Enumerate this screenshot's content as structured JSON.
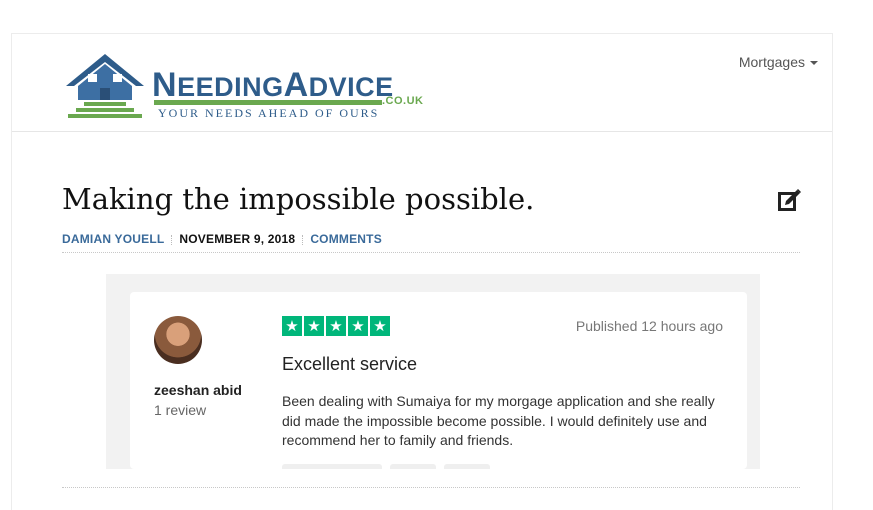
{
  "logo": {
    "name_big_first": "N",
    "name_rest": "EEDING",
    "name_big_second": "A",
    "name_rest2": "DVICE",
    "domain_suffix": ".CO.UK",
    "tagline": "YOUR NEEDS AHEAD OF OURS",
    "colors": {
      "blue": "#2e5c8a",
      "green": "#6aa84f"
    }
  },
  "nav": {
    "mortgages_label": "Mortgages"
  },
  "post": {
    "title": "Making the impossible possible.",
    "author": "DAMIAN YOUELL",
    "date": "NOVEMBER 9, 2018",
    "comments": "COMMENTS",
    "edit_icon": "edit-icon"
  },
  "review": {
    "reviewer_name": "zeeshan abid",
    "review_count": "1 review",
    "rating": 5,
    "star_glyph": "★",
    "star_color": "#00b67a",
    "published": "Published 12 hours ago",
    "title": "Excellent service",
    "body": "Been dealing with Sumaiya for my morgage application and she really did made the impossible become possible. I would definitely use and recommend her to family and friends."
  }
}
